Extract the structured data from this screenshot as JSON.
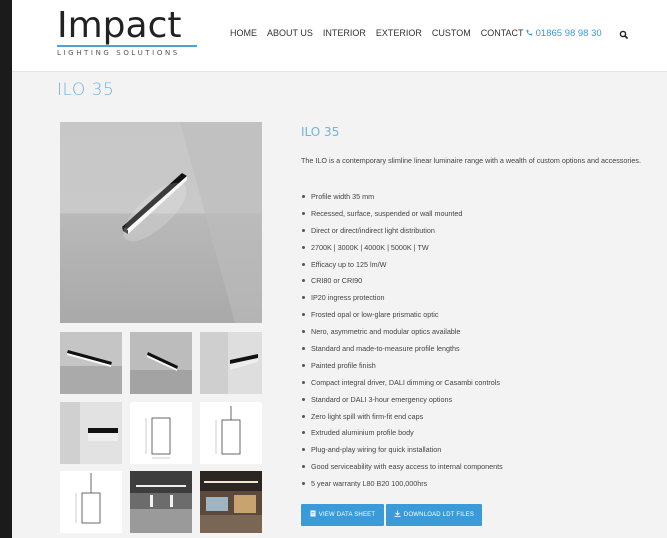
{
  "header": {
    "logo_word": "Impact",
    "logo_sub": "LIGHTING SOLUTIONS",
    "nav": [
      "HOME",
      "ABOUT US",
      "INTERIOR",
      "EXTERIOR",
      "CUSTOM",
      "CONTACT"
    ],
    "phone": "01865 98 98 30",
    "phone_icon": "phone-icon",
    "search_icon": "search-icon"
  },
  "page": {
    "title": "ILO 35"
  },
  "product": {
    "title": "ILO 35",
    "description": "The ILO is a contemporary slimline linear luminaire range with a wealth of custom options and accessories.",
    "features": [
      "Profile width 35 mm",
      "Recessed, surface, suspended or wall mounted",
      "Direct or direct/indirect light distribution",
      "2700K | 3000K | 4000K | 5000K | TW",
      "Efficacy up to 125 lm/W",
      "CRI80 or CRI90",
      "IP20 ingress protection",
      "Frosted opal or low-glare prismatic optic",
      "Nero, asymmetric and modular optics available",
      "Standard and made-to-measure profile lengths",
      "Painted profile finish",
      "Compact integral driver, DALI dimming or Casambi controls",
      "Standard or DALI 3-hour emergency options",
      "Zero light spill with firm-fit end caps",
      "Extruded aluminium profile body",
      "Plug-and-play wiring for quick installation",
      "Good serviceability with easy access to internal components",
      "5 year warranty L80 B20 100,000hrs"
    ],
    "buttons": {
      "data_sheet": "VIEW DATA SHEET",
      "ldt_files": "DOWNLOAD LDT FILES"
    }
  },
  "colors": {
    "accent": "#3a9bd8",
    "title": "#6fb5e0"
  }
}
